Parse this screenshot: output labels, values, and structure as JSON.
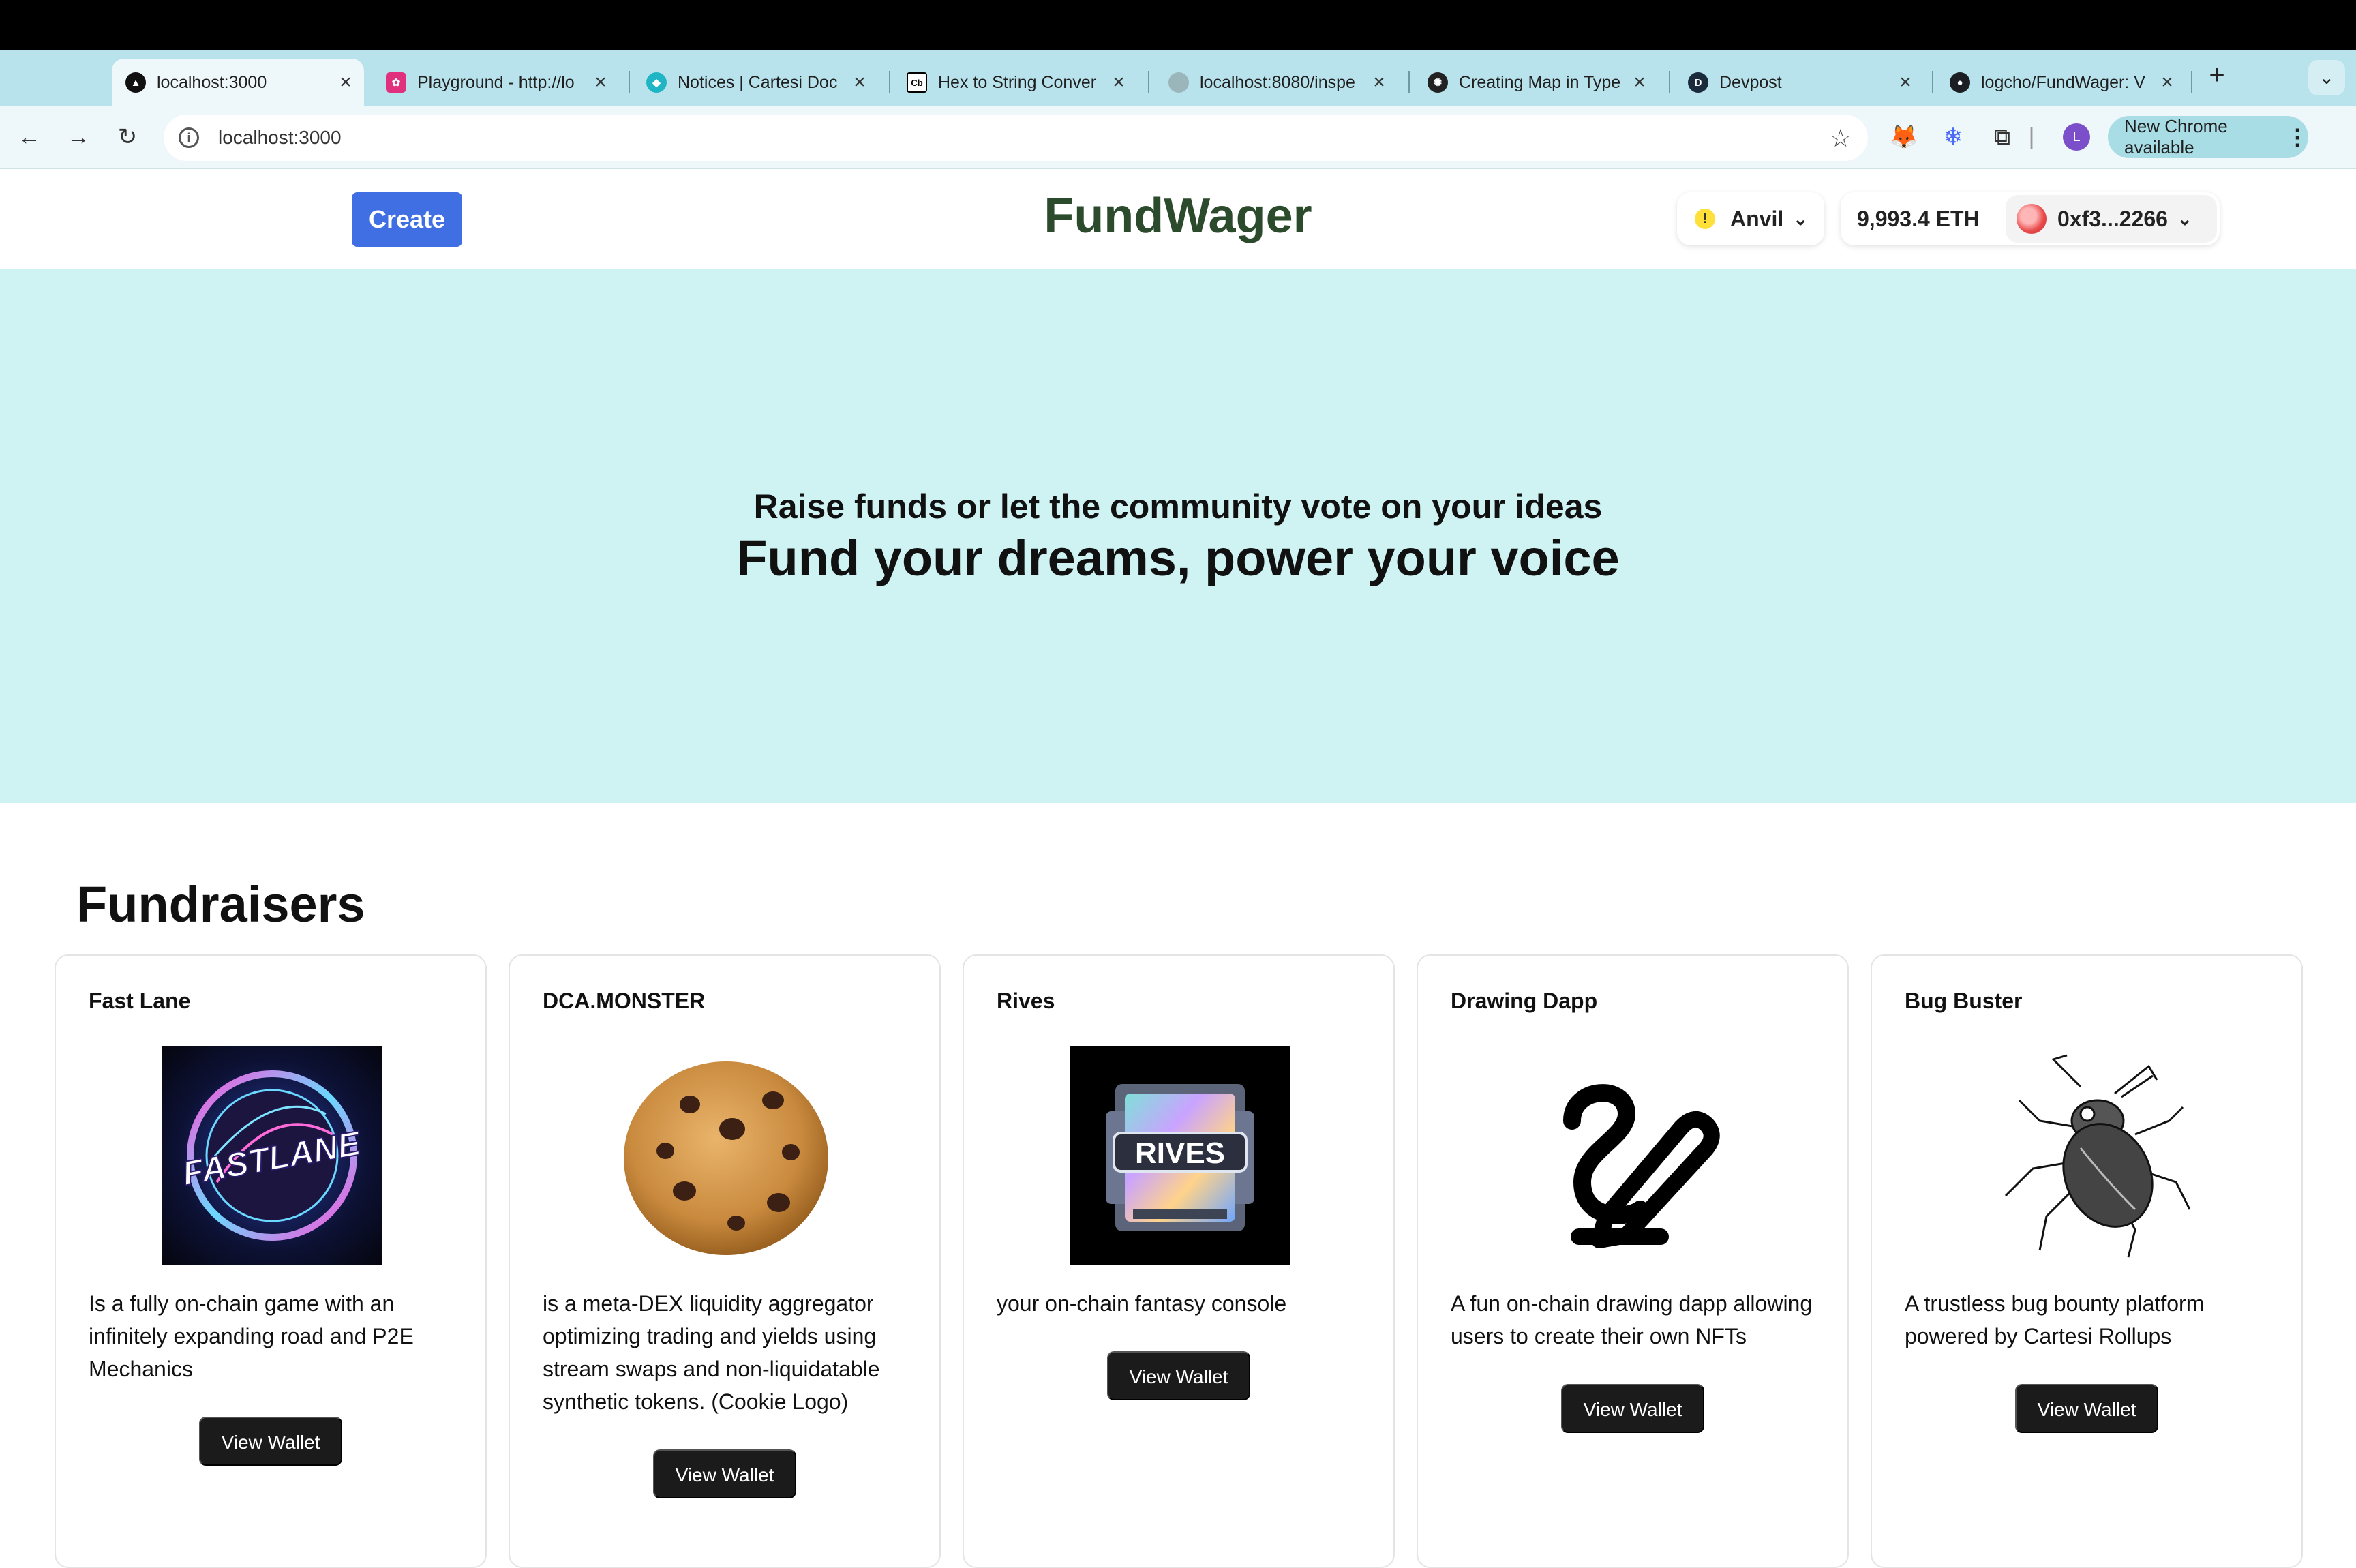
{
  "browser": {
    "tabs": [
      {
        "title": "localhost:3000",
        "favicon": "triangle-icon"
      },
      {
        "title": "Playground - http://lo",
        "favicon": "playground-icon"
      },
      {
        "title": "Notices | Cartesi Doc",
        "favicon": "cartesi-icon"
      },
      {
        "title": "Hex to String Conver",
        "favicon": "cb-icon"
      },
      {
        "title": "localhost:8080/inspe",
        "favicon": "globe-icon"
      },
      {
        "title": "Creating Map in Type",
        "favicon": "openai-icon"
      },
      {
        "title": "Devpost",
        "favicon": "devpost-icon"
      },
      {
        "title": "logcho/FundWager: V",
        "favicon": "github-icon"
      }
    ],
    "url": "localhost:3000",
    "update_label": "New Chrome available",
    "profile_initial": "L"
  },
  "header": {
    "create_label": "Create",
    "brand": "FundWager",
    "network": "Anvil",
    "balance": "9,993.4 ETH",
    "address": "0xf3...2266"
  },
  "hero": {
    "subtitle": "Raise funds or let the community vote on your ideas",
    "title": "Fund your dreams, power your voice"
  },
  "fundraisers": {
    "heading": "Fundraisers",
    "items": [
      {
        "name": "Fast Lane",
        "description": "Is a fully on-chain game with an infinitely expanding road and P2E Mechanics",
        "button": "View Wallet"
      },
      {
        "name": "DCA.MONSTER",
        "description": "is a meta-DEX liquidity aggregator optimizing trading and yields using stream swaps and non-liquidatable synthetic tokens. (Cookie Logo)",
        "button": "View Wallet"
      },
      {
        "name": "Rives",
        "description": "your on-chain fantasy console",
        "button": "View Wallet",
        "logo_text": "RIVES"
      },
      {
        "name": "Drawing Dapp",
        "description": "A fun on-chain drawing dapp allowing users to create their own NFTs",
        "button": "View Wallet"
      },
      {
        "name": "Bug Buster",
        "description": "A trustless bug bounty platform powered by Cartesi Rollups",
        "button": "View Wallet"
      }
    ]
  },
  "colors": {
    "hero_bg": "#cff3f3",
    "create_button": "#3f6fe3",
    "brand_text": "#2c4a2c",
    "wallet_button": "#1b1b1b"
  }
}
